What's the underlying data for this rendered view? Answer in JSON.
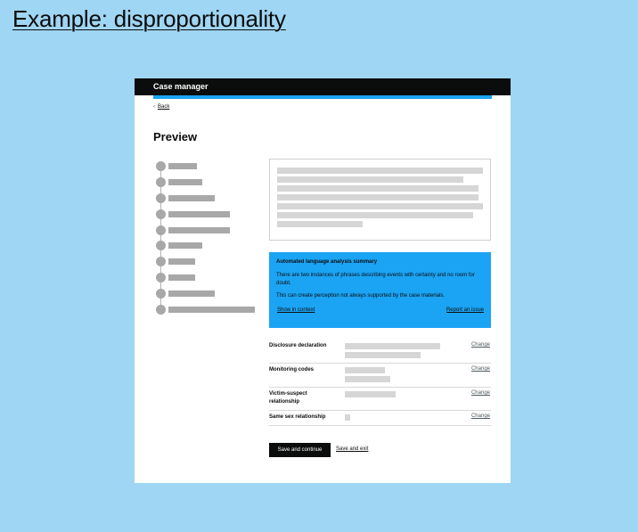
{
  "slide": {
    "title": "Example: disproportionality"
  },
  "app": {
    "title": "Case manager"
  },
  "nav": {
    "back_label": "Back",
    "back_icon": "chevron-left-icon"
  },
  "page": {
    "heading": "Preview"
  },
  "steps": {
    "count": 10
  },
  "summary_panel": {
    "title": "Automated language analysis summary",
    "paragraph_1": "There are two instances of phrases describing events with certainty and no room for doubt.",
    "paragraph_2": "This can create perception not always supported by the case materials.",
    "show_link": "Show in context",
    "report_link": "Report an issue",
    "background_color": "#1ba4f4"
  },
  "summary_list": [
    {
      "key": "Disclosure declaration",
      "action": "Change"
    },
    {
      "key": "Monitoring codes",
      "action": "Change"
    },
    {
      "key": "Victim-suspect relationship",
      "action": "Change"
    },
    {
      "key": "Same sex relationship",
      "action": "Change"
    }
  ],
  "actions": {
    "primary": "Save and continue",
    "secondary": "Save and exit"
  },
  "colors": {
    "page_background": "#9fd6f3",
    "header": "#0b0c0c",
    "accent": "#1ba4f4"
  }
}
